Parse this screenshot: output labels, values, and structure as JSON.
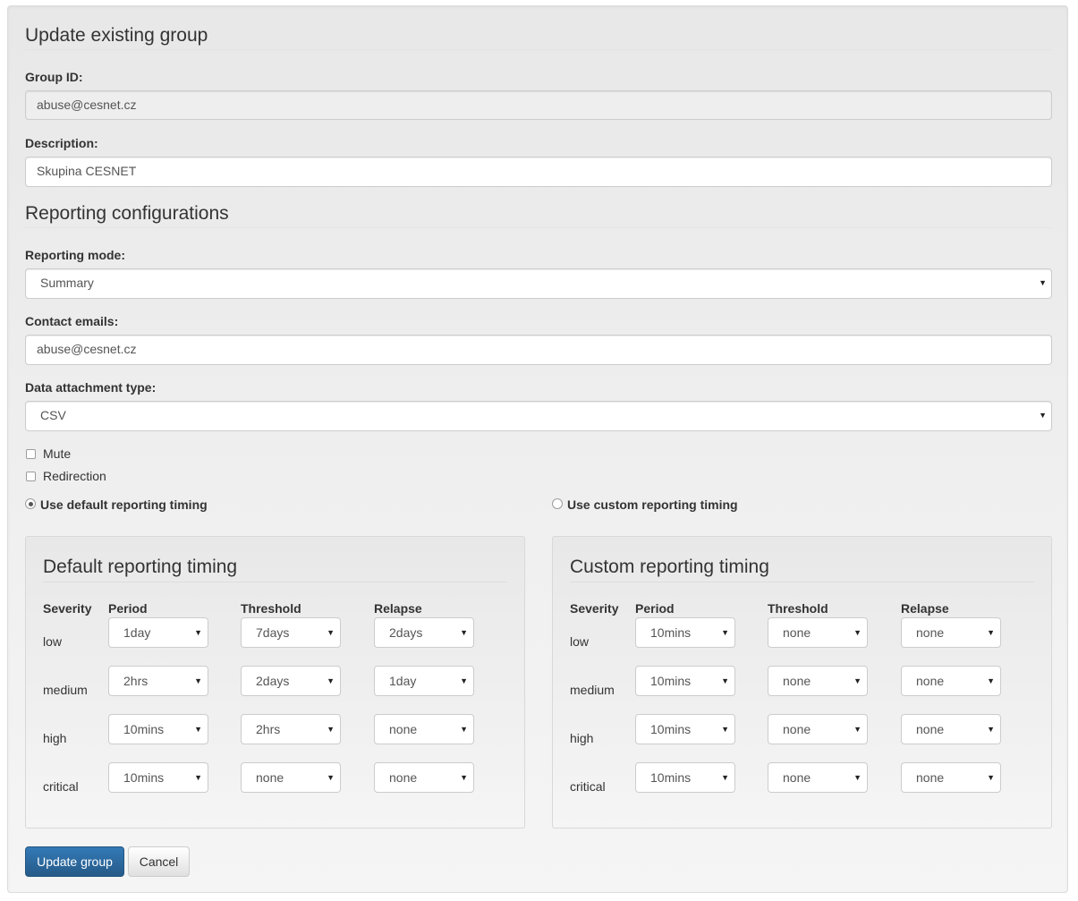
{
  "page_title": "Update existing group",
  "group_id": {
    "label": "Group ID:",
    "value": "abuse@cesnet.cz"
  },
  "description": {
    "label": "Description:",
    "value": "Skupina CESNET"
  },
  "reporting_title": "Reporting configurations",
  "reporting_mode": {
    "label": "Reporting mode:",
    "value": "Summary"
  },
  "contact_emails": {
    "label": "Contact emails:",
    "value": "abuse@cesnet.cz"
  },
  "attachment_type": {
    "label": "Data attachment type:",
    "value": "CSV"
  },
  "mute": {
    "label": "Mute",
    "checked": false
  },
  "redirection": {
    "label": "Redirection",
    "checked": false
  },
  "timing_choice": {
    "default_label": "Use default reporting timing",
    "custom_label": "Use custom reporting timing",
    "selected": "default"
  },
  "default_timing": {
    "title": "Default reporting timing",
    "headers": {
      "severity": "Severity",
      "period": "Period",
      "threshold": "Threshold",
      "relapse": "Relapse"
    },
    "rows": [
      {
        "severity": "low",
        "period": "1day",
        "threshold": "7days",
        "relapse": "2days"
      },
      {
        "severity": "medium",
        "period": "2hrs",
        "threshold": "2days",
        "relapse": "1day"
      },
      {
        "severity": "high",
        "period": "10mins",
        "threshold": "2hrs",
        "relapse": "none"
      },
      {
        "severity": "critical",
        "period": "10mins",
        "threshold": "none",
        "relapse": "none"
      }
    ]
  },
  "custom_timing": {
    "title": "Custom reporting timing",
    "headers": {
      "severity": "Severity",
      "period": "Period",
      "threshold": "Threshold",
      "relapse": "Relapse"
    },
    "rows": [
      {
        "severity": "low",
        "period": "10mins",
        "threshold": "none",
        "relapse": "none"
      },
      {
        "severity": "medium",
        "period": "10mins",
        "threshold": "none",
        "relapse": "none"
      },
      {
        "severity": "high",
        "period": "10mins",
        "threshold": "none",
        "relapse": "none"
      },
      {
        "severity": "critical",
        "period": "10mins",
        "threshold": "none",
        "relapse": "none"
      }
    ]
  },
  "buttons": {
    "submit": "Update group",
    "cancel": "Cancel"
  },
  "icons": {
    "caret": "caret-down-icon",
    "checkbox": "checkbox-icon",
    "radio": "radio-icon"
  },
  "colors": {
    "primary": "#337ab7",
    "well_bg": "#eeeeee"
  }
}
